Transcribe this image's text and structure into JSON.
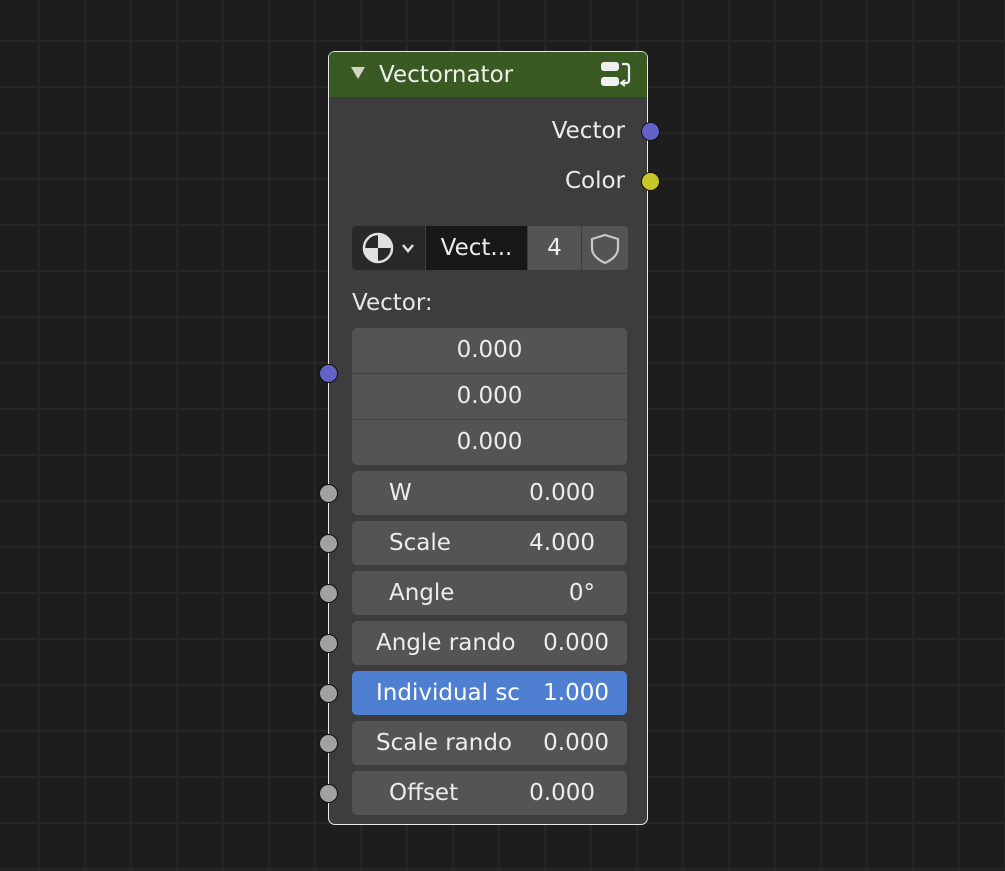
{
  "node": {
    "title": "Vectornator",
    "outputs": [
      {
        "label": "Vector",
        "socket": "vector"
      },
      {
        "label": "Color",
        "socket": "color"
      }
    ],
    "texture": {
      "browse_icon": "texture-browse-icon",
      "name": "Vect...",
      "users": "4",
      "fake_user_icon": "shield-icon"
    },
    "vector_label": "Vector:",
    "vector_values": [
      "0.000",
      "0.000",
      "0.000"
    ],
    "fields": [
      {
        "label": "W",
        "value": "0.000"
      },
      {
        "label": "Scale",
        "value": "4.000"
      },
      {
        "label": "Angle",
        "value": "0°"
      },
      {
        "label": "Angle rando",
        "value": "0.000"
      },
      {
        "label": "Individual sc",
        "value": "1.000",
        "active": true
      },
      {
        "label": "Scale rando",
        "value": "0.000"
      },
      {
        "label": "Offset",
        "value": "0.000"
      }
    ]
  },
  "colors": {
    "header": "#3a5a24",
    "vector_socket": "#6363c7",
    "color_socket": "#c7c729",
    "value_socket": "#a1a1a1",
    "active_field": "#4e7fd0"
  }
}
